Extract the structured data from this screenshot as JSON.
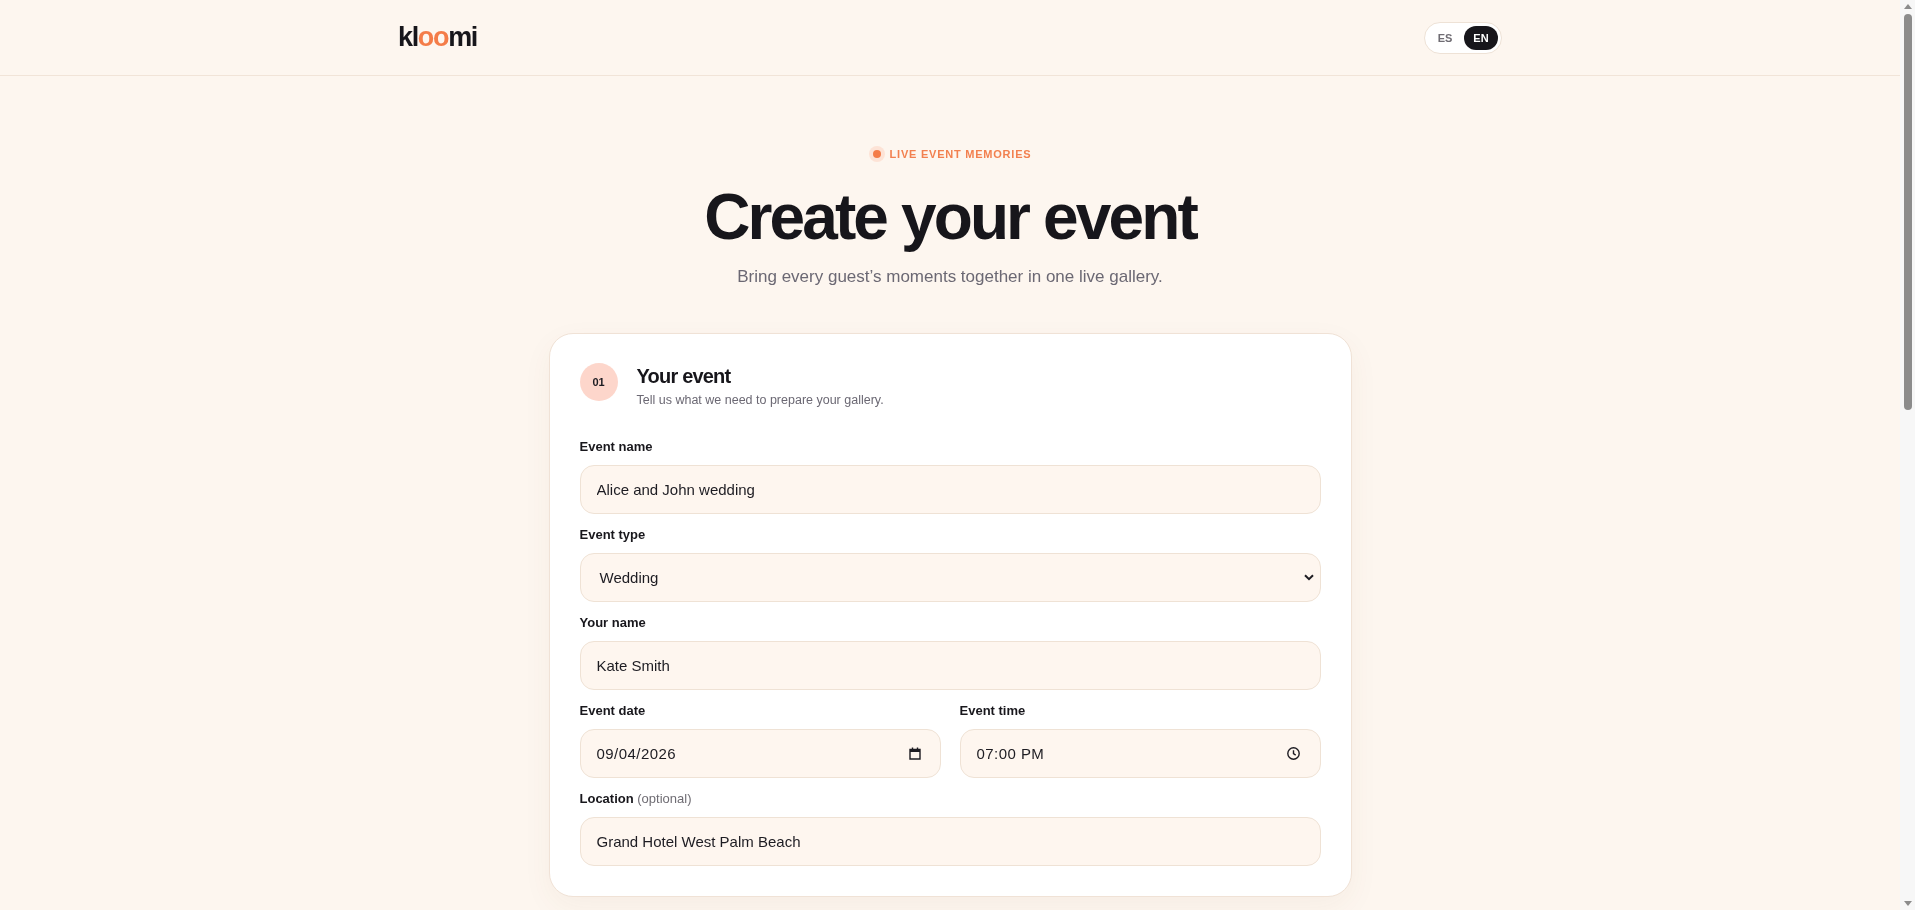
{
  "header": {
    "logo": [
      {
        "text": "kl",
        "accent": false
      },
      {
        "text": "oo",
        "accent": true
      },
      {
        "text": "mi",
        "accent": false
      }
    ],
    "languages": [
      {
        "label": "ES",
        "selected": false
      },
      {
        "label": "EN",
        "selected": true
      }
    ]
  },
  "hero": {
    "eyebrow": "LIVE EVENT MEMORIES",
    "title": "Create your event",
    "subtitle": "Bring every guest’s moments together in one live gallery."
  },
  "form_card": {
    "step": "01",
    "title": "Your event",
    "subtitle": "Tell us what we need to prepare your gallery.",
    "fields": [
      {
        "kind": "text",
        "label": "Event name",
        "value": "Alice and John wedding"
      },
      {
        "kind": "select",
        "label": "Event type",
        "value": "Wedding"
      },
      {
        "kind": "text",
        "label": "Your name",
        "value": "Kate Smith"
      },
      {
        "kind": "date",
        "label": "Event date",
        "value": "09/04/2026"
      },
      {
        "kind": "time",
        "label": "Event time",
        "value": "07:00 PM"
      },
      {
        "kind": "text",
        "label": "Location",
        "note": "(optional)",
        "value": "Grand Hotel West Palm Beach"
      }
    ]
  }
}
